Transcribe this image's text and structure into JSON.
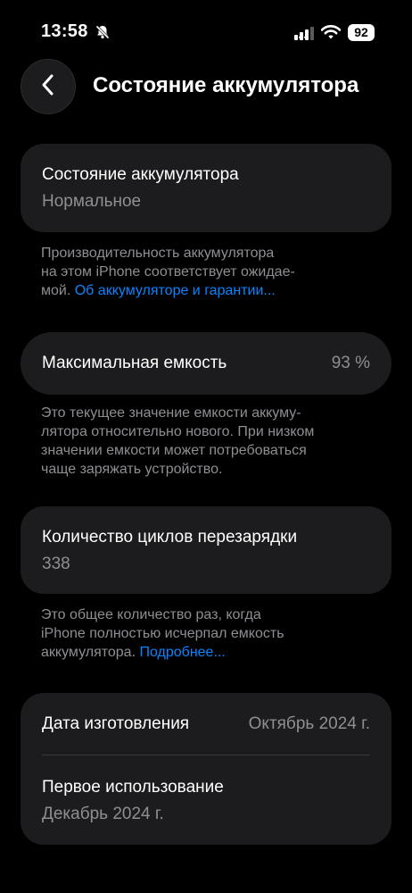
{
  "status_bar": {
    "time": "13:58",
    "battery_level": "92"
  },
  "header": {
    "title": "Состояние аккумулятора"
  },
  "health": {
    "label": "Состояние аккумулятора",
    "value": "Нормальное",
    "note_lines": [
      "Производительность аккумулятора",
      "на этом iPhone соответствует ожидае-",
      "мой."
    ],
    "link": "Об аккумуляторе и гарантии..."
  },
  "capacity": {
    "label": "Максимальная емкость",
    "value": "93 %",
    "note_lines": [
      "Это текущее значение емкости аккуму-",
      "лятора относительно нового. При низком",
      "значении емкости может потребоваться",
      "чаще заряжать устройство."
    ]
  },
  "cycles": {
    "label": "Количество циклов перезарядки",
    "value": "338",
    "note_lines": [
      "Это общее количество раз, когда",
      "iPhone полностью исчерпал емкость",
      "аккумулятора."
    ],
    "link": "Подробнее..."
  },
  "dates": {
    "manufacture_label": "Дата изготовления",
    "manufacture_value": "Октябрь 2024 г.",
    "first_use_label": "Первое использование",
    "first_use_value": "Декабрь 2024 г."
  },
  "colors": {
    "background": "#000000",
    "card": "#1c1c1e",
    "secondary_text": "#8e8e93",
    "link": "#0a84ff"
  }
}
